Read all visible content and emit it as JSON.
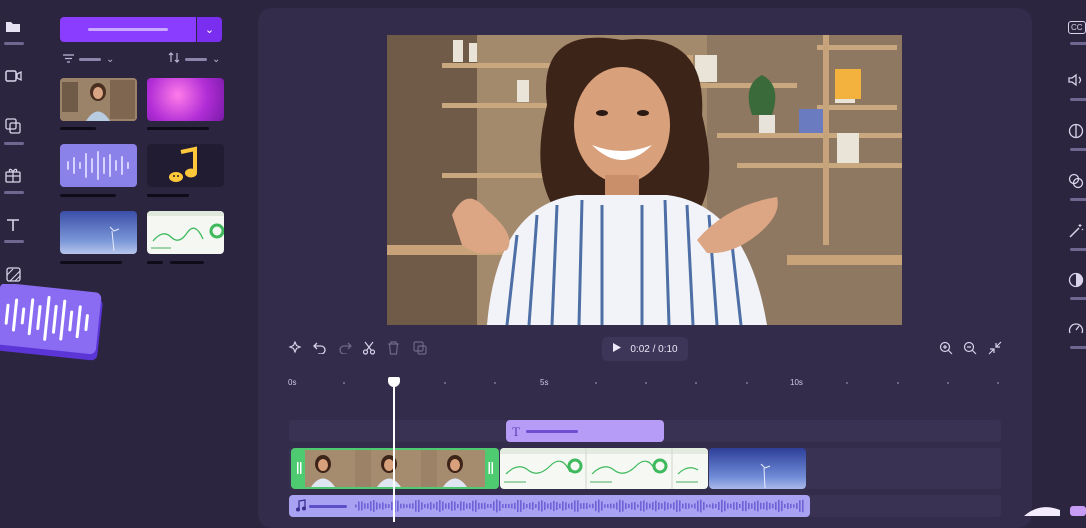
{
  "player": {
    "play_icon": "play-icon",
    "time": "0:02 / 0:10"
  },
  "timeline": {
    "ticks": [
      "0s",
      "5s",
      "10s"
    ]
  },
  "left_rail": {
    "icons": [
      "folder-icon",
      "video-camera-icon",
      "media-swap-icon",
      "templates-icon",
      "text-icon",
      "transitions-icon"
    ]
  },
  "right_rail": {
    "icons": [
      "captions-icon",
      "volume-icon",
      "fade-icon",
      "filters-icon",
      "magic-wand-icon",
      "color-adjust-icon",
      "speed-icon"
    ]
  },
  "right_rail_text": {
    "captions": "CC"
  },
  "text_clip": {
    "icon": "T"
  },
  "colors": {
    "accent": "#8b3dff",
    "background": "#2b2540",
    "stage": "#332c4a",
    "audio": "#a9a1f2",
    "text_clip": "#b79cf7",
    "video_clip_border": "#4ecb71"
  }
}
